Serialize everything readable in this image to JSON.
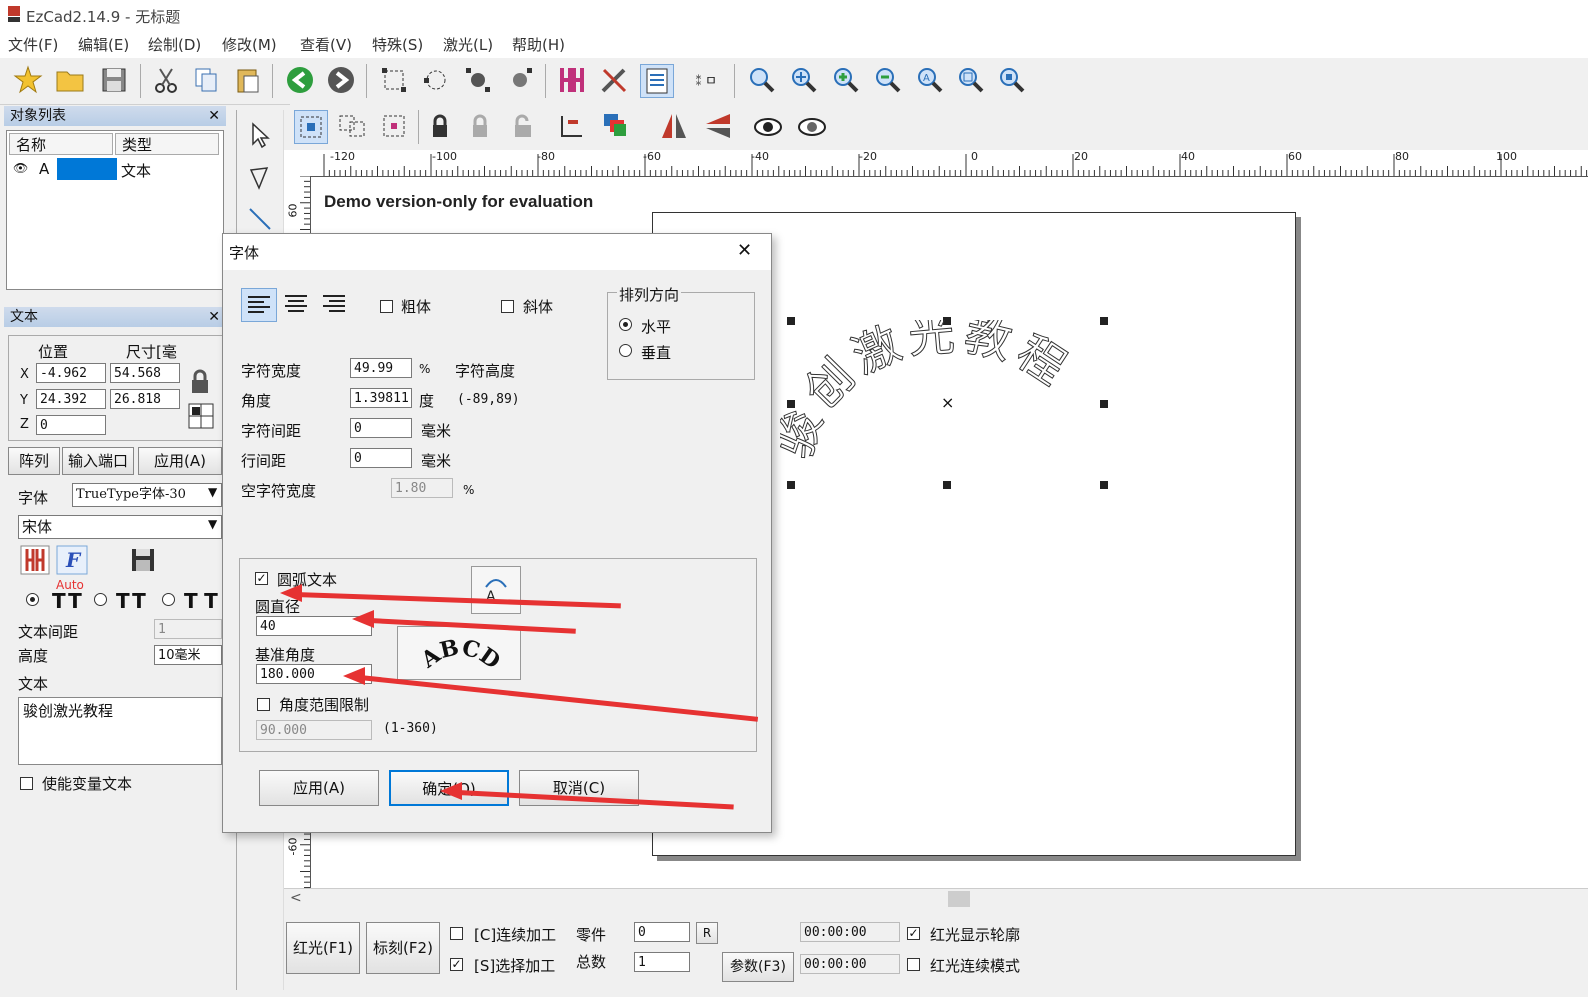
{
  "window": {
    "title": "EzCad2.14.9 - 无标题"
  },
  "menu": [
    "文件(F)",
    "编辑(E)",
    "绘制(D)",
    "修改(M)",
    "查看(V)",
    "特殊(S)",
    "激光(L)",
    "帮助(H)"
  ],
  "object_list": {
    "title": "对象列表",
    "col_name": "名称",
    "col_type": "类型",
    "row_name": "A",
    "row_type": "文本"
  },
  "text_panel": {
    "title": "文本",
    "pos_label": "位置",
    "size_label": "尺寸[毫",
    "x_label": "X",
    "y_label": "Y",
    "z_label": "Z",
    "x_pos": "-4.962",
    "x_size": "54.568",
    "y_pos": "24.392",
    "y_size": "26.818",
    "z_pos": "0",
    "btn_array": "阵列",
    "btn_port": "输入端口",
    "btn_apply": "应用(A)",
    "font_label": "字体",
    "font_type": "TrueType字体-30",
    "font_name": "宋体",
    "auto_label": "Auto",
    "spacing_label": "文本间距",
    "spacing_value": "1",
    "height_label": "高度",
    "height_value": "10毫米",
    "text_label": "文本",
    "text_value": "骏创激光教程",
    "variable_label": "使能变量文本"
  },
  "canvas": {
    "demo_text": "Demo version-only for evaluation",
    "arc_text": "骏创激光教程",
    "ruler_labels": [
      "-120",
      "-100",
      "-80",
      "-60",
      "-40",
      "-20",
      "0",
      "20",
      "40",
      "60",
      "80",
      "100"
    ],
    "vruler_top": "60",
    "vruler_bottom": "-60"
  },
  "dialog": {
    "title": "字体",
    "bold_label": "粗体",
    "italic_label": "斜体",
    "direction_group": "排列方向",
    "horizontal_label": "水平",
    "vertical_label": "垂直",
    "char_width_label": "字符宽度",
    "char_width_value": "49.99",
    "char_width_unit": "%",
    "char_height_label": "字符高度",
    "angle_label": "角度",
    "angle_value": "1.39811",
    "angle_unit": "度",
    "angle_range": "(-89,89)",
    "char_spacing_label": "字符间距",
    "char_spacing_value": "0",
    "line_spacing_label": "行间距",
    "line_spacing_value": "0",
    "mm_unit": "毫米",
    "space_width_label": "空字符宽度",
    "space_width_value": "1.80",
    "space_width_unit": "%",
    "arc_text_label": "圆弧文本",
    "diameter_label": "圆直径",
    "diameter_value": "40",
    "base_angle_label": "基准角度",
    "base_angle_value": "180.000",
    "abcd_preview": "ABCD",
    "angle_limit_label": "角度范围限制",
    "angle_limit_value": "90.000",
    "angle_limit_range": "(1-360)",
    "apply_btn": "应用(A)",
    "ok_btn": "确定(O)",
    "cancel_btn": "取消(C)"
  },
  "bottom": {
    "red_btn": "红光(F1)",
    "mark_btn": "标刻(F2)",
    "continuous_label": "[C]连续加工",
    "select_label": "[S]选择加工",
    "parts_label": "零件",
    "parts_value": "0",
    "r_btn": "R",
    "total_label": "总数",
    "total_value": "1",
    "params_btn": "参数(F3)",
    "time1": "00:00:00",
    "time2": "00:00:00",
    "red_outline_label": "红光显示轮廓",
    "red_continuous_label": "红光连续模式"
  },
  "colors": {
    "accent": "#0078d7",
    "arrow": "#e63232",
    "panel_header": "#c3d4ea"
  }
}
